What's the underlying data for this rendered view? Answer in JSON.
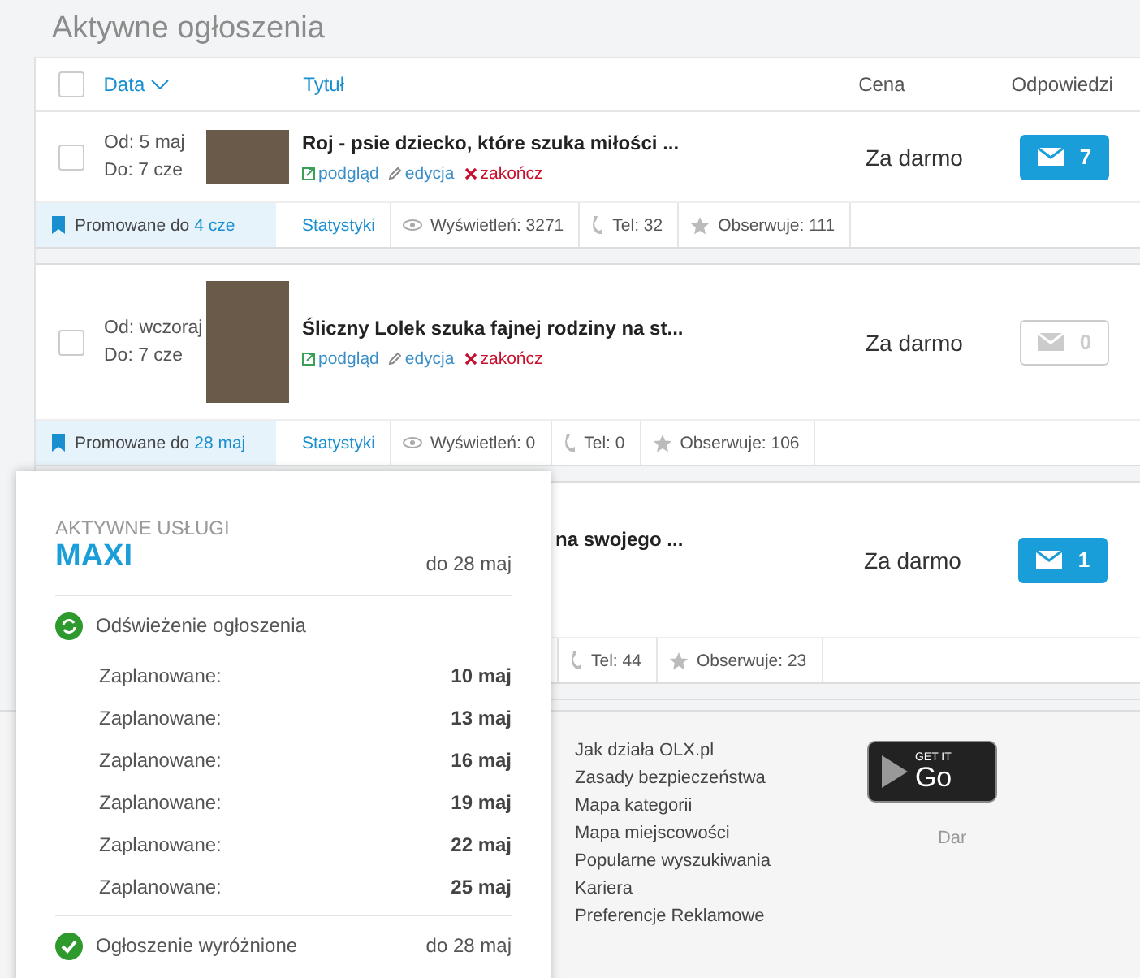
{
  "header": {
    "title": "Aktywne ogłoszenia"
  },
  "table": {
    "select_all": {
      "checked": false
    },
    "columns": [
      {
        "kind": "sortable",
        "label": "Data"
      },
      {
        "kind": "link",
        "label": "Tytuł"
      },
      {
        "kind": "plain",
        "label": "Cena"
      },
      {
        "kind": "plain",
        "label": "Odpowiedzi"
      }
    ],
    "rows": [
      {
        "covered": false,
        "checked": false,
        "dates": [
          "Od: 5 maj",
          "Do: 7 cze"
        ],
        "photo_tall": false,
        "title": "Roj - psie dziecko, które szuka miłości ...",
        "actions": [
          {
            "kind": "preview",
            "label": "podgląd"
          },
          {
            "kind": "edit",
            "label": "edycja"
          },
          {
            "kind": "end",
            "label": "zakończ"
          }
        ],
        "price": "Za darmo",
        "replies": {
          "count": "7",
          "unread": true
        },
        "promo": {
          "label": "Promowane do",
          "date": "4 cze"
        },
        "stats": [
          {
            "kind": "link",
            "label": "Statystyki"
          },
          {
            "kind": "views",
            "label": "Wyświetleń: 3271"
          },
          {
            "kind": "phone",
            "label": "Tel: 32"
          },
          {
            "kind": "watch",
            "label": "Obserwuje: 111"
          }
        ]
      },
      {
        "covered": false,
        "checked": false,
        "dates": [
          "Od: wczoraj",
          "Do: 7 cze"
        ],
        "photo_tall": true,
        "title": "Śliczny Lolek szuka fajnej rodziny na st...",
        "actions": [
          {
            "kind": "preview",
            "label": "podgląd"
          },
          {
            "kind": "edit",
            "label": "edycja"
          },
          {
            "kind": "end",
            "label": "zakończ"
          }
        ],
        "price": "Za darmo",
        "replies": {
          "count": "0",
          "unread": false
        },
        "promo": {
          "label": "Promowane do",
          "date": "28 maj"
        },
        "stats": [
          {
            "kind": "link",
            "label": "Statystyki"
          },
          {
            "kind": "views",
            "label": "Wyświetleń: 0"
          },
          {
            "kind": "phone",
            "label": "Tel: 0"
          },
          {
            "kind": "watch",
            "label": "Obserwuje: 106"
          }
        ]
      },
      {
        "covered": true,
        "title": "na swojego ...",
        "price": "Za darmo",
        "replies": {
          "count": "1",
          "unread": true
        },
        "stats": [
          {
            "kind": "phone",
            "label": "Tel: 44"
          },
          {
            "kind": "watch",
            "label": "Obserwuje: 23"
          }
        ]
      }
    ]
  },
  "popover": {
    "heading": "AKTYWNE USŁUGI",
    "package": "MAXI",
    "until": "do 28 maj",
    "services": [
      {
        "kind": "refresh",
        "label": "Odświeżenie ogłoszenia",
        "schedule": [
          {
            "label": "Zaplanowane:",
            "date": "10 maj"
          },
          {
            "label": "Zaplanowane:",
            "date": "13 maj"
          },
          {
            "label": "Zaplanowane:",
            "date": "16 maj"
          },
          {
            "label": "Zaplanowane:",
            "date": "19 maj"
          },
          {
            "label": "Zaplanowane:",
            "date": "22 maj"
          },
          {
            "label": "Zaplanowane:",
            "date": "25 maj"
          }
        ]
      },
      {
        "kind": "check",
        "label": "Ogłoszenie wyróżnione",
        "until": "do 28 maj"
      }
    ]
  },
  "footer": {
    "links": [
      "Jak działa OLX.pl",
      "Zasady bezpieczeństwa",
      "Mapa kategorii",
      "Mapa miejscowości",
      "Popularne wyszukiwania",
      "Kariera",
      "Preferencje Reklamowe"
    ],
    "app_badge": {
      "small": "GET IT",
      "big": "Go"
    },
    "note": "Dar"
  }
}
